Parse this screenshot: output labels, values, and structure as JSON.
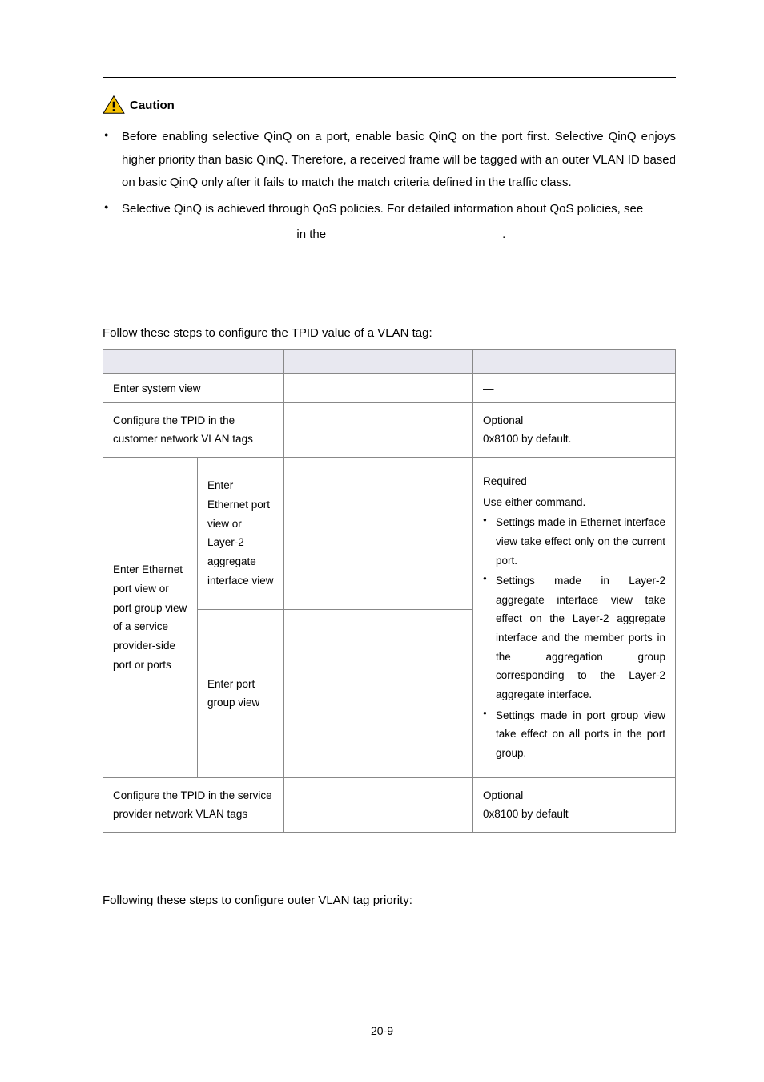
{
  "caution": {
    "label": "Caution",
    "bullets": [
      "Before enabling selective QinQ on a port, enable basic QinQ on the port first. Selective QinQ enjoys higher priority than basic QinQ. Therefore, a received frame will be tagged with an outer VLAN ID based on basic QinQ only after it fails to match the match criteria defined in the traffic class.",
      "Selective QinQ is achieved through QoS policies. For detailed information about QoS policies, see"
    ],
    "trailing_in_the": "in the",
    "trailing_dot": "."
  },
  "tpid": {
    "intro": "Follow these steps to configure the TPID value of a VLAN tag:",
    "rows": {
      "r1": {
        "todo": "Enter system view",
        "remarks": "—"
      },
      "r2": {
        "todo": "Configure the TPID in the customer network VLAN tags",
        "remarks_l1": "Optional",
        "remarks_l2": "0x8100 by default."
      },
      "r3": {
        "todo_group": "Enter Ethernet port view or port group view of a service provider-side port or ports",
        "sub1": "Enter Ethernet port view or Layer-2 aggregate interface view",
        "sub2": "Enter port group view",
        "remarks_l1": "Required",
        "remarks_l2": "Use either command.",
        "remarks_b1": "Settings made in Ethernet interface view take effect only on the current port.",
        "remarks_b2": "Settings made in Layer-2 aggregate interface view take effect on the Layer-2 aggregate interface and the member ports in the aggregation group corresponding to the Layer-2 aggregate interface.",
        "remarks_b3": "Settings made in port group view take effect on all ports in the port group."
      },
      "r4": {
        "todo": "Configure the TPID in the service provider network VLAN tags",
        "remarks_l1": "Optional",
        "remarks_l2": "0x8100 by default"
      }
    }
  },
  "priority": {
    "intro": "Following these steps to configure outer VLAN tag priority:"
  },
  "page_number": "20-9",
  "icons": {
    "caution_triangle": "caution-triangle-icon"
  }
}
